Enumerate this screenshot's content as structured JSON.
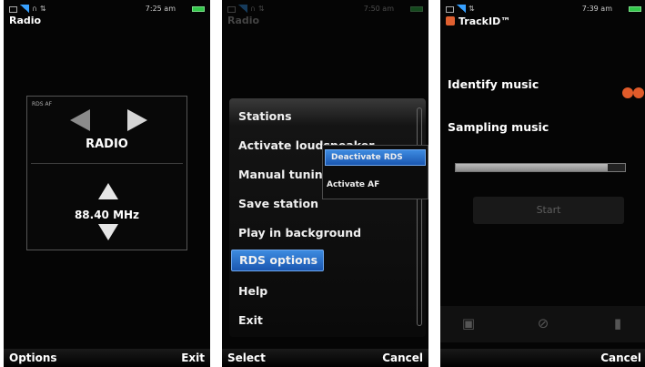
{
  "screen1": {
    "time": "7:25 am",
    "title": "Radio",
    "rds_label": "RDS AF",
    "radio_label": "RADIO",
    "frequency": "88.40 MHz",
    "softkey_left": "Options",
    "softkey_right": "Exit"
  },
  "screen2": {
    "time": "7:50 am",
    "title": "Radio",
    "menu_items": [
      "Stations",
      "Activate loudspeaker",
      "Manual tuning",
      "Save station",
      "Play in background",
      "RDS options",
      "Help",
      "Exit"
    ],
    "selected_index": 5,
    "submenu_items": [
      "Deactivate RDS",
      "Activate AF"
    ],
    "softkey_left": "Select",
    "softkey_right": "Cancel"
  },
  "screen3": {
    "time": "7:39 am",
    "title": "TrackID™",
    "identify_label": "Identify music",
    "sampling_label": "Sampling music",
    "progress_fraction": 0.9,
    "start_label": "Start",
    "softkey_right": "Cancel"
  },
  "colors": {
    "highlight": "#2a70d0",
    "battery": "#32c84a",
    "signal": "#37a0ff"
  }
}
